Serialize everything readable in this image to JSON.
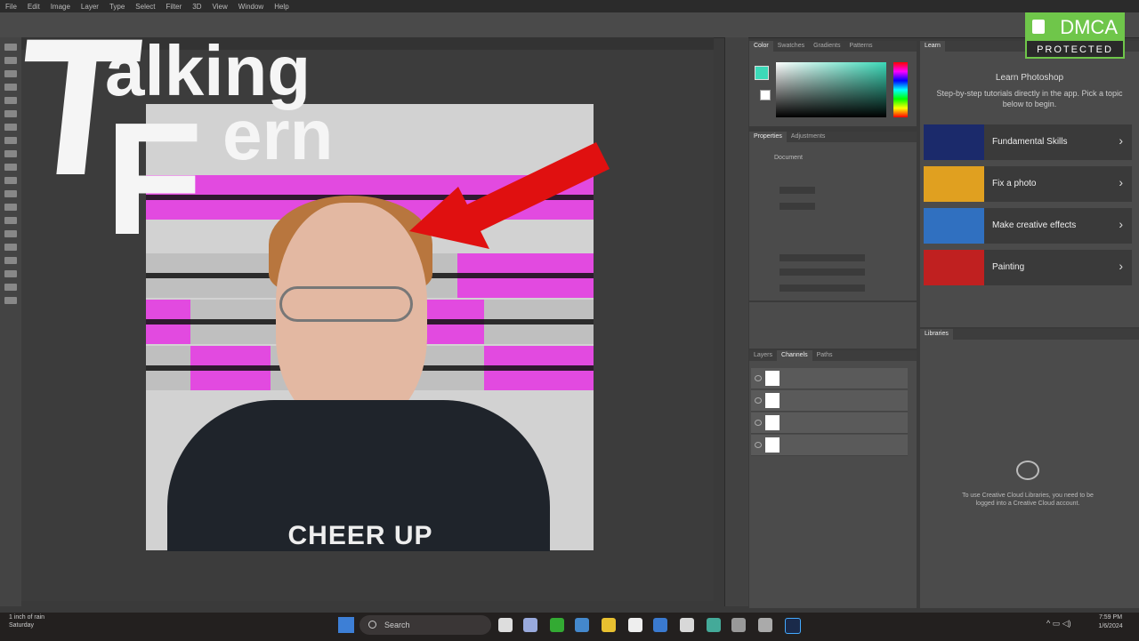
{
  "menu": [
    "File",
    "Edit",
    "Image",
    "Layer",
    "Type",
    "Select",
    "Filter",
    "3D",
    "View",
    "Window",
    "Help"
  ],
  "overlay": {
    "line1_big": "T",
    "line1_rest": "alking",
    "line2_big": "F",
    "line2_rest": "ern",
    "shirt_text": "CHEER UP"
  },
  "panels": {
    "color_tabs": [
      "Color",
      "Swatches",
      "Gradients",
      "Patterns"
    ],
    "props_tabs": [
      "Properties",
      "Adjustments"
    ],
    "props_doc_label": "Document",
    "layers_tabs": [
      "Layers",
      "Channels",
      "Paths"
    ],
    "learn_tab": "Learn",
    "learn_title": "Learn Photoshop",
    "learn_subtitle": "Step-by-step tutorials directly in the app. Pick a topic below to begin.",
    "lessons": [
      {
        "label": "Fundamental Skills",
        "color": "#1b2a6b"
      },
      {
        "label": "Fix a photo",
        "color": "#e0a020"
      },
      {
        "label": "Make creative effects",
        "color": "#3070c0"
      },
      {
        "label": "Painting",
        "color": "#c02020"
      }
    ],
    "libraries_tab": "Libraries",
    "libraries_msg": "To use Creative Cloud Libraries, you need to be logged into a Creative Cloud account."
  },
  "dmca": {
    "top": "DMCA",
    "bottom": "PROTECTED"
  },
  "taskbar": {
    "search_placeholder": "Search",
    "weather_line1": "1 inch of rain",
    "weather_line2": "Saturday",
    "clock_time": "7:59 PM",
    "clock_date": "1/6/2024"
  },
  "colors": {
    "fg": "#3cd9b8",
    "clip": "#e24ae0",
    "arrow": "#e01010",
    "dmca": "#6fc64a"
  }
}
